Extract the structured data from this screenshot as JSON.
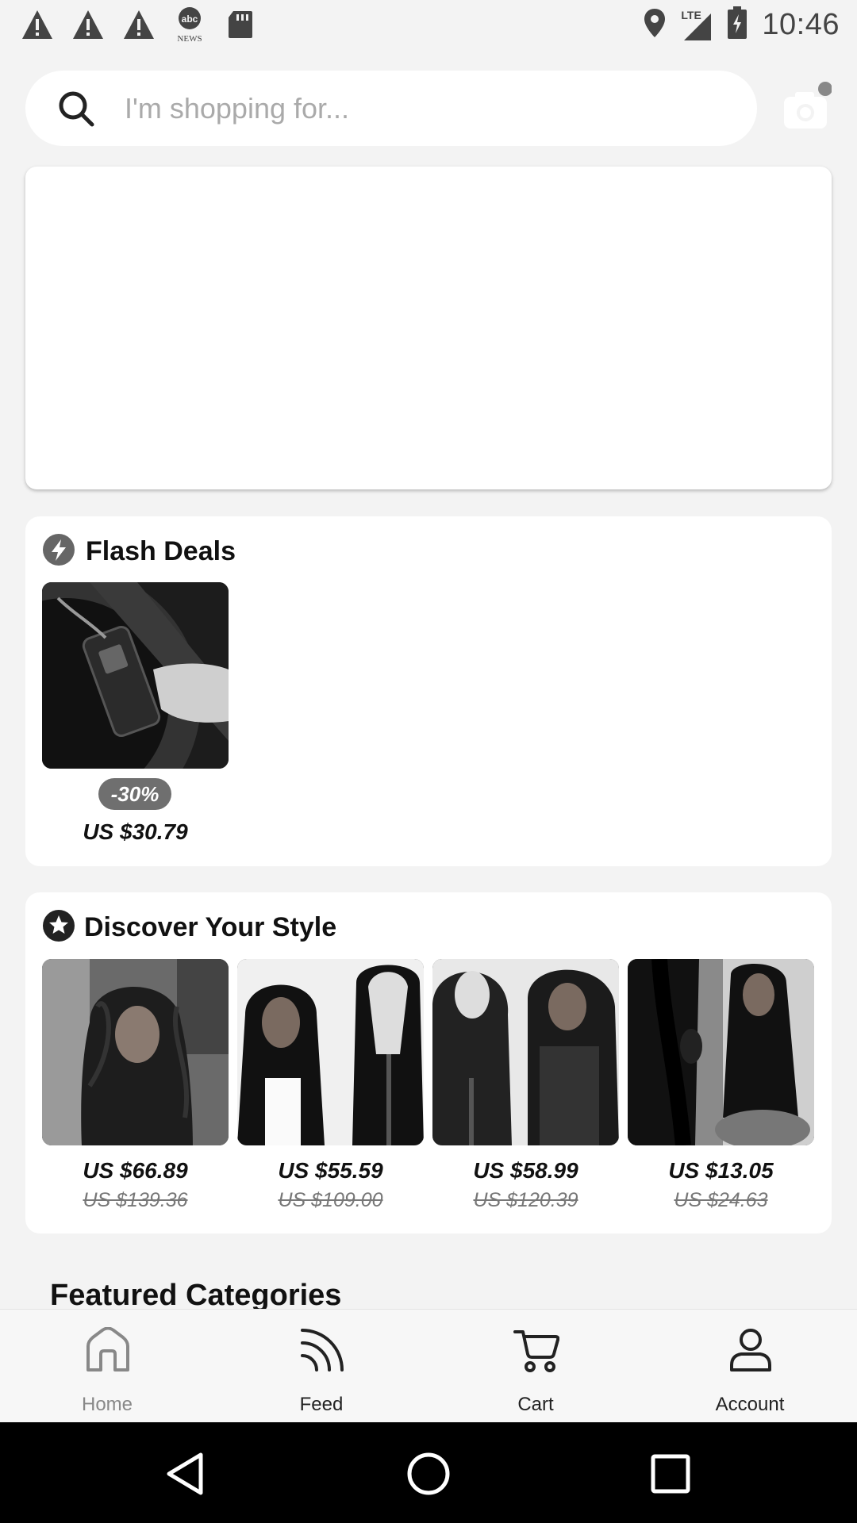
{
  "status_bar": {
    "time": "10:46",
    "network": "LTE",
    "left_icons": [
      "warning-icon",
      "warning-icon",
      "warning-icon",
      "abc-news-icon",
      "sd-card-icon"
    ],
    "abc_news_label": "NEWS"
  },
  "search": {
    "placeholder": "I'm shopping for..."
  },
  "flash_deals": {
    "title": "Flash Deals",
    "items": [
      {
        "discount": "-30%",
        "price": "US $30.79"
      }
    ]
  },
  "discover": {
    "title": "Discover Your Style",
    "items": [
      {
        "price": "US $66.89",
        "old_price": "US $139.36"
      },
      {
        "price": "US $55.59",
        "old_price": "US $109.00"
      },
      {
        "price": "US $58.99",
        "old_price": "US $120.39"
      },
      {
        "price": "US $13.05",
        "old_price": "US $24.63"
      }
    ]
  },
  "featured": {
    "title": "Featured Categories"
  },
  "tabs": [
    {
      "label": "Home",
      "icon": "home-icon",
      "active": false
    },
    {
      "label": "Feed",
      "icon": "feed-icon",
      "active": true
    },
    {
      "label": "Cart",
      "icon": "cart-icon",
      "active": true
    },
    {
      "label": "Account",
      "icon": "account-icon",
      "active": true
    }
  ],
  "colors": {
    "background": "#f3f3f3",
    "card": "#ffffff",
    "badge": "#6f6f6f",
    "navbar": "#000000"
  }
}
